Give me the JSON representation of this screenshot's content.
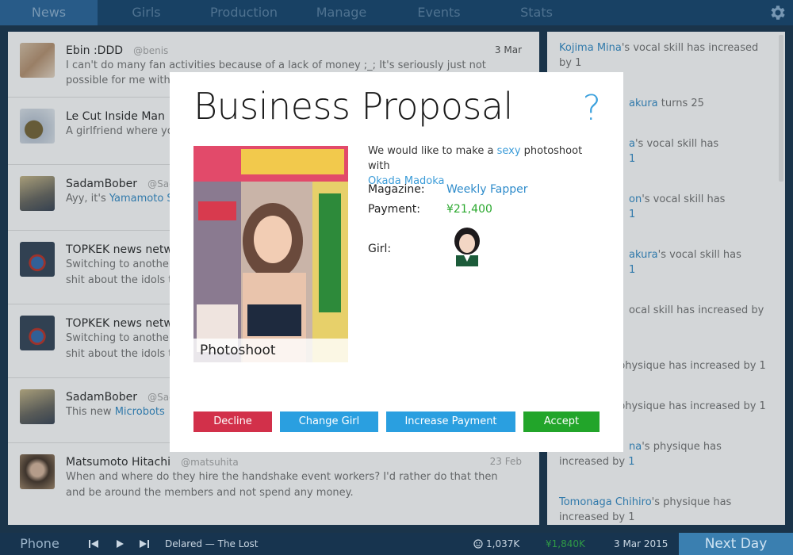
{
  "nav": {
    "tabs": [
      "News",
      "Girls",
      "Production",
      "Manage",
      "Events",
      "Stats"
    ],
    "active": "News",
    "settings_icon": "gear-icon"
  },
  "feed": [
    {
      "name": "Ebin :DDD",
      "handle": "@benis",
      "date": "3 Mar",
      "text_parts": [
        "I can't do many fan activities because of a lack of money ;_; It's seriously just not possible for me with"
      ],
      "highlight": []
    },
    {
      "name": "Le Cut Inside Man",
      "handle": "",
      "date": "",
      "text_parts": [
        "A girlfriend where you"
      ],
      "highlight": []
    },
    {
      "name": "SadamBober",
      "handle": "@Sad",
      "date": "",
      "text_parts": [
        "Ayy, it's "
      ],
      "highlight": [
        "Yamamoto Sa"
      ]
    },
    {
      "name": "TOPKEK news netwo",
      "handle": "",
      "date": "",
      "text_parts": [
        "Switching to another",
        "shit about the idols th"
      ],
      "highlight": []
    },
    {
      "name": "TOPKEK news netwo",
      "handle": "",
      "date": "",
      "text_parts": [
        "Switching to another",
        "shit about the idols th"
      ],
      "highlight": []
    },
    {
      "name": "SadamBober",
      "handle": "@Sad",
      "date": "",
      "text_parts": [
        "This new "
      ],
      "highlight": [
        "Microbots"
      ]
    },
    {
      "name": "Matsumoto Hitachi",
      "handle": "@matsuhita",
      "date": "23 Feb",
      "text_parts": [
        "When and where do they hire the handshake event workers? I'd rather do that then",
        "and be around the members and not spend any money."
      ],
      "highlight": []
    }
  ],
  "log": [
    {
      "hl": "Kojima Mina",
      "text": "'s vocal skill has increased by 1",
      "tail_hl": ""
    },
    {
      "hl": "akura",
      "text": " turns 25",
      "tail_hl": ""
    },
    {
      "hl": "a",
      "text": "'s vocal skill has",
      "tail_hl": "1"
    },
    {
      "hl": "on",
      "text": "'s vocal skill has",
      "tail_hl": "1"
    },
    {
      "hl": "akura",
      "text": "'s vocal skill has",
      "tail_hl": "1"
    },
    {
      "hl": "",
      "text": "ocal skill has increased by",
      "tail_hl": ""
    },
    {
      "hl": "",
      "text": "physique has increased by 1",
      "tail_hl": ""
    },
    {
      "hl": "",
      "text": "physique has increased by 1",
      "tail_hl": ""
    },
    {
      "hl": "na",
      "text": "'s physique has increased by ",
      "tail_hl": "1"
    },
    {
      "hl": "Tomonaga Chihiro",
      "text": "'s physique has increased by 1",
      "tail_hl": ""
    }
  ],
  "modal": {
    "title": "Business Proposal",
    "help": "?",
    "description_prefix": "We would like to make a ",
    "description_hl": "sexy",
    "description_mid": " photoshoot with",
    "description_girl": "Okada Madoka",
    "magazine_label": "Magazine:",
    "magazine_value": "Weekly Fapper",
    "payment_label": "Payment:",
    "payment_value": "¥21,400",
    "girl_label": "Girl:",
    "cover_label": "Photoshoot",
    "buttons": {
      "decline": "Decline",
      "change_girl": "Change Girl",
      "increase_payment": "Increase Payment",
      "accept": "Accept"
    }
  },
  "bottom": {
    "phone": "Phone",
    "song": "Delared — The Lost",
    "fans": "1,037K",
    "money": "¥1,840K",
    "date": "3 Mar 2015",
    "next_day": "Next Day"
  },
  "colors": {
    "nav_bg": "#1b4a72",
    "decline": "#d2304a",
    "change_girl": "#2a9fe0",
    "increase_payment": "#2a9fe0",
    "accept": "#22a52a",
    "next_day": "#3a7fb0"
  }
}
